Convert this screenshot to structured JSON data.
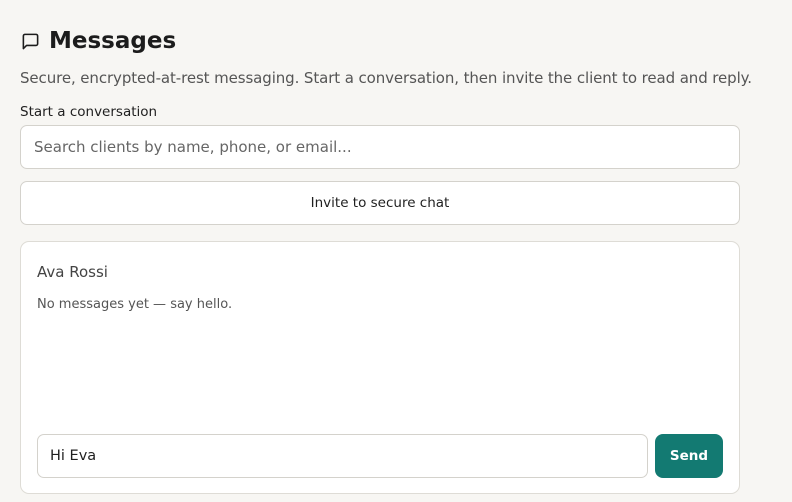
{
  "header": {
    "icon": "message-square-icon",
    "title": "Messages"
  },
  "subtitle": "Secure, encrypted-at-rest messaging. Start a conversation, then invite the client to read and reply.",
  "start": {
    "label": "Start a conversation",
    "search_placeholder": "Search clients by name, phone, or email...",
    "invite_label": "Invite to secure chat"
  },
  "chat": {
    "client_name": "Ava Rossi",
    "empty_text": "No messages yet — say hello.",
    "composer_value": "Hi Eva",
    "send_label": "Send"
  },
  "colors": {
    "background": "#f7f6f3",
    "accent": "#137a72",
    "border": "#d4d2cc"
  }
}
